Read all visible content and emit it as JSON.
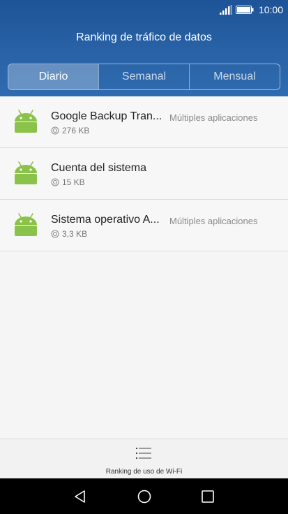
{
  "status_bar": {
    "time": "10:00"
  },
  "header": {
    "title": "Ranking de tráfico de datos"
  },
  "tabs": [
    {
      "label": "Diario",
      "active": true
    },
    {
      "label": "Semanal",
      "active": false
    },
    {
      "label": "Mensual",
      "active": false
    }
  ],
  "apps": [
    {
      "name": "Google Backup Tran...",
      "tag": "Múltiples aplicaciones",
      "size": "276 KB",
      "icon": "android-icon"
    },
    {
      "name": "Cuenta del sistema",
      "tag": "",
      "size": "15 KB",
      "icon": "android-icon"
    },
    {
      "name": "Sistema operativo A...",
      "tag": "Múltiples aplicaciones",
      "size": "3,3 KB",
      "icon": "android-icon"
    }
  ],
  "bottom": {
    "label": "Ranking de uso de Wi-Fi",
    "icon": "list-menu-icon"
  },
  "colors": {
    "header": "#2a64a8",
    "android_green": "#8bc34a"
  }
}
